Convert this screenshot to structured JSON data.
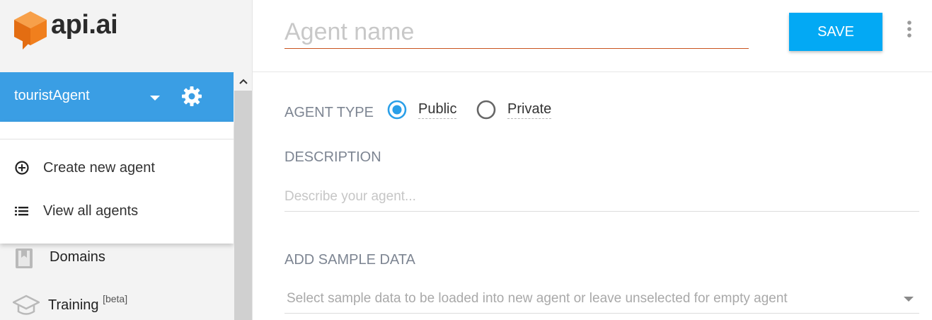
{
  "brand": {
    "logo_text": "api.ai",
    "accent": "#3a9ee4",
    "logo_color": "#f07f1d"
  },
  "sidebar": {
    "agent_selector": {
      "name": "touristAgent"
    },
    "dropdown_menu": [
      {
        "label": "Create new agent",
        "icon": "add-circle-icon"
      },
      {
        "label": "View all agents",
        "icon": "list-icon"
      }
    ],
    "nav": [
      {
        "label": "Domains",
        "icon": "book-icon"
      },
      {
        "label": "Training",
        "badge": "[beta]",
        "icon": "graduation-cap-icon"
      }
    ]
  },
  "header": {
    "agent_name_placeholder": "Agent name",
    "agent_name_value": "",
    "save_label": "SAVE"
  },
  "form": {
    "agent_type_label": "AGENT TYPE",
    "agent_type_options": [
      {
        "label": "Public",
        "selected": true
      },
      {
        "label": "Private",
        "selected": false
      }
    ],
    "description_label": "DESCRIPTION",
    "description_placeholder": "Describe your agent...",
    "sample_data_label": "ADD SAMPLE DATA",
    "sample_data_placeholder": "Select sample data to be loaded into new agent or leave unselected for empty agent"
  }
}
